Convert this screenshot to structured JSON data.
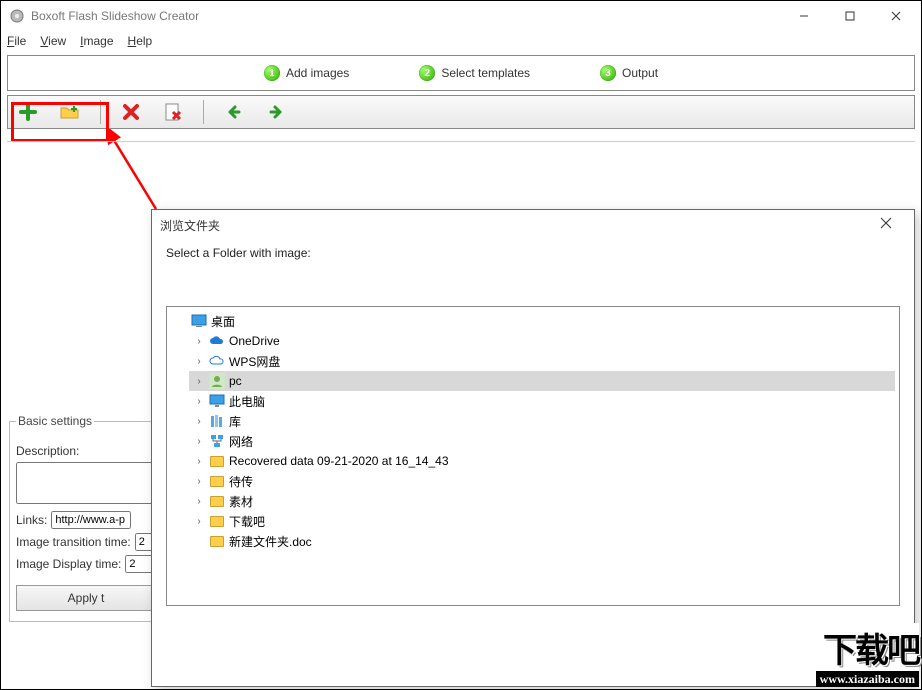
{
  "window": {
    "title": "Boxoft Flash Slideshow Creator"
  },
  "menu": {
    "file": "File",
    "view": "View",
    "image": "Image",
    "help": "Help"
  },
  "steps": {
    "s1": "Add images",
    "s2": "Select templates",
    "s3": "Output"
  },
  "settings": {
    "legend": "Basic settings",
    "description_label": "Description:",
    "links_label": "Links:",
    "links_value": "http://www.a-p",
    "transition_label": "Image transition time:",
    "transition_value": "2",
    "display_label": "Image Display time:",
    "display_value": "2",
    "apply_label": "Apply t"
  },
  "dialog": {
    "title": "浏览文件夹",
    "prompt": "Select a Folder with image:",
    "tree": {
      "root": "桌面",
      "items": [
        {
          "label": "OneDrive",
          "icon": "cloud-blue"
        },
        {
          "label": "WPS网盘",
          "icon": "cloud-outline"
        },
        {
          "label": "pc",
          "icon": "user",
          "selected": true
        },
        {
          "label": "此电脑",
          "icon": "monitor"
        },
        {
          "label": "库",
          "icon": "library"
        },
        {
          "label": "网络",
          "icon": "network"
        },
        {
          "label": "Recovered data 09-21-2020 at 16_14_43",
          "icon": "folder"
        },
        {
          "label": "待传",
          "icon": "folder"
        },
        {
          "label": "素材",
          "icon": "folder"
        },
        {
          "label": "下载吧",
          "icon": "folder"
        },
        {
          "label": "新建文件夹.doc",
          "icon": "folder"
        }
      ]
    }
  },
  "watermark": {
    "big": "下载吧",
    "url": "www.xiazaiba.com"
  }
}
